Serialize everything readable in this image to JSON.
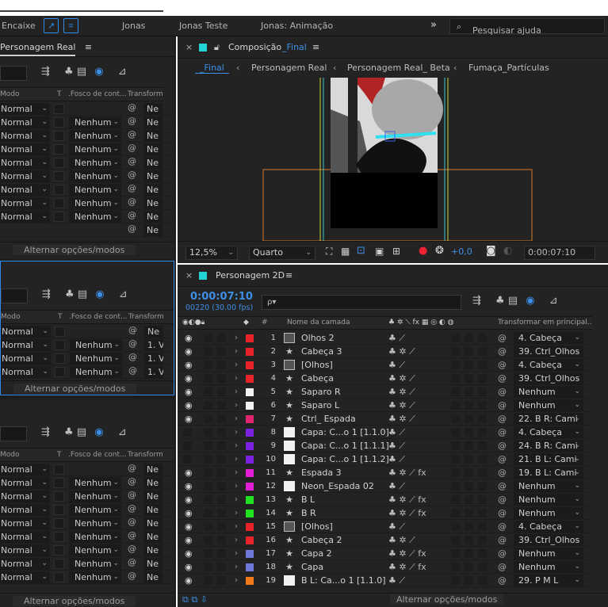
{
  "workspace": {
    "encaixe_label": "Encaixe",
    "tabs": [
      "Jonas",
      "Jonas Teste",
      "Jonas: Animação"
    ],
    "overflow": "»",
    "help_placeholder": "Pesquisar ajuda"
  },
  "project_panels": [
    {
      "title": "Personagem Real",
      "menu": "≡",
      "columns": {
        "modo": "Modo",
        "t": "T",
        "fosco": ".Fosco de cont...",
        "transform": "Transform"
      },
      "rows": [
        {
          "mode": "Normal",
          "fosco": "",
          "trf": "Ne"
        },
        {
          "mode": "Normal",
          "fosco": "Nenhum",
          "trf": "Ne"
        },
        {
          "mode": "Normal",
          "fosco": "Nenhum",
          "trf": "Ne"
        },
        {
          "mode": "Normal",
          "fosco": "Nenhum",
          "trf": "Ne"
        },
        {
          "mode": "Normal",
          "fosco": "Nenhum",
          "trf": "Ne"
        },
        {
          "mode": "Normal",
          "fosco": "Nenhum",
          "trf": "Ne"
        },
        {
          "mode": "Normal",
          "fosco": "Nenhum",
          "trf": "Ne"
        },
        {
          "mode": "Normal",
          "fosco": "Nenhum",
          "trf": "Ne"
        },
        {
          "mode": "Normal",
          "fosco": "Nenhum",
          "trf": "Ne"
        },
        {
          "mode": "",
          "fosco": "",
          "trf": "Ne"
        }
      ],
      "toggle": "Alternar opções/modos"
    },
    {
      "title": "",
      "columns": {
        "modo": "Modo",
        "t": "T",
        "fosco": ".Fosco de cont...",
        "transform": "Transform"
      },
      "rows": [
        {
          "mode": "Normal",
          "fosco": "",
          "trf": "Ne"
        },
        {
          "mode": "Normal",
          "fosco": "Nenhum",
          "trf": "1. V"
        },
        {
          "mode": "Normal",
          "fosco": "Nenhum",
          "trf": "1. V"
        },
        {
          "mode": "Normal",
          "fosco": "Nenhum",
          "trf": "1. V"
        }
      ],
      "toggle": "Alternar opções/modos"
    },
    {
      "title": "",
      "columns": {
        "modo": "Modo",
        "t": "T",
        "fosco": ".Fosco de cont...",
        "transform": "Transform"
      },
      "rows": [
        {
          "mode": "Normal",
          "fosco": "",
          "trf": "Ne"
        },
        {
          "mode": "Normal",
          "fosco": "Nenhum",
          "trf": "Ne"
        },
        {
          "mode": "Normal",
          "fosco": "Nenhum",
          "trf": "Ne"
        },
        {
          "mode": "Normal",
          "fosco": "Nenhum",
          "trf": "Ne"
        },
        {
          "mode": "Normal",
          "fosco": "Nenhum",
          "trf": "Ne"
        },
        {
          "mode": "Normal",
          "fosco": "Nenhum",
          "trf": "Ne"
        },
        {
          "mode": "Normal",
          "fosco": "Nenhum",
          "trf": "Ne"
        },
        {
          "mode": "Normal",
          "fosco": "Nenhum",
          "trf": "Ne"
        },
        {
          "mode": "Normal",
          "fosco": "Nenhum",
          "trf": "Ne"
        }
      ],
      "toggle": "Alternar opções/modos"
    }
  ],
  "composition": {
    "close": "×",
    "title": "Composição",
    "name": "_Final",
    "menu": "≡",
    "breadcrumbs": [
      "_Final",
      "Personagem Real",
      "Personagem Real_ Beta",
      "Fumaça_Partículas"
    ],
    "zoom": "12,5%",
    "resolution": "Quarto",
    "exposure": "+0,0",
    "current_time": "0:00:07:10"
  },
  "timeline": {
    "close": "×",
    "title": "Personagem 2D",
    "menu": "≡",
    "timecode": "0:00:07:10",
    "frames": "00220 (30.00 fps)",
    "search_placeholder": "ρ▾",
    "columns": {
      "num": "#",
      "name": "Nome da camada",
      "parent": "Transformar em principal..."
    },
    "layers": [
      {
        "num": "1",
        "name": "Olhos 2",
        "label": "#e8232a",
        "type": "comp",
        "eye": true,
        "shy": false,
        "fx": false,
        "parent": "4. Cabeça"
      },
      {
        "num": "2",
        "name": "Cabeça 3",
        "label": "#e8232a",
        "type": "star",
        "eye": true,
        "shy": true,
        "fx": false,
        "parent": "39. Ctrl_Olhos"
      },
      {
        "num": "3",
        "name": "[Olhos]",
        "label": "#e8232a",
        "type": "comp",
        "eye": true,
        "shy": false,
        "fx": false,
        "parent": "4. Cabeça"
      },
      {
        "num": "4",
        "name": "Cabeça",
        "label": "#e8232a",
        "type": "star",
        "eye": true,
        "shy": true,
        "fx": false,
        "parent": "39. Ctrl_Olhos"
      },
      {
        "num": "5",
        "name": "Saparo R",
        "label": "#f2f2f2",
        "type": "star",
        "eye": true,
        "shy": true,
        "fx": false,
        "parent": "Nenhum"
      },
      {
        "num": "6",
        "name": "Saparo L",
        "label": "#f2f2f2",
        "type": "star",
        "eye": true,
        "shy": true,
        "fx": false,
        "parent": "Nenhum"
      },
      {
        "num": "7",
        "name": "Ctrl_ Espada",
        "label": "#e0246f",
        "type": "star",
        "eye": true,
        "shy": true,
        "fx": false,
        "parent": "22. B R: Cami"
      },
      {
        "num": "8",
        "name": "Capa: C...o 1 [1.1.0]",
        "label": "#7a22e0",
        "type": "solid",
        "eye": false,
        "shy": false,
        "fx": false,
        "parent": "4. Cabeça"
      },
      {
        "num": "9",
        "name": "Capa: C...o 1 [1.1.1]",
        "label": "#7a22e0",
        "type": "solid",
        "eye": false,
        "shy": false,
        "fx": false,
        "parent": "24. B R: Cami"
      },
      {
        "num": "10",
        "name": "Capa: C...o 1 [1.1.2]",
        "label": "#7a22e0",
        "type": "solid",
        "eye": false,
        "shy": false,
        "fx": false,
        "parent": "21. B L: Cami"
      },
      {
        "num": "11",
        "name": "Espada 3",
        "label": "#e21fd6",
        "type": "star",
        "eye": true,
        "shy": true,
        "fx": true,
        "parent": "19. B L: Cami"
      },
      {
        "num": "12",
        "name": "Neon_Espada 02",
        "label": "#e21fd6",
        "type": "solid",
        "eye": true,
        "shy": false,
        "fx": false,
        "parent": "Nenhum"
      },
      {
        "num": "13",
        "name": "B L",
        "label": "#22e022",
        "type": "star",
        "eye": true,
        "shy": true,
        "fx": true,
        "parent": "Nenhum"
      },
      {
        "num": "14",
        "name": "B R",
        "label": "#22e022",
        "type": "star",
        "eye": true,
        "shy": true,
        "fx": true,
        "parent": "Nenhum"
      },
      {
        "num": "15",
        "name": "[Olhos]",
        "label": "#e8232a",
        "type": "comp",
        "eye": true,
        "shy": false,
        "fx": false,
        "parent": "4. Cabeça"
      },
      {
        "num": "16",
        "name": "Cabeça 2",
        "label": "#e8232a",
        "type": "star",
        "eye": true,
        "shy": true,
        "fx": false,
        "parent": "39. Ctrl_Olhos"
      },
      {
        "num": "17",
        "name": "Capa 2",
        "label": "#6f78d8",
        "type": "star",
        "eye": true,
        "shy": true,
        "fx": true,
        "parent": "Nenhum"
      },
      {
        "num": "18",
        "name": "Capa",
        "label": "#6f78d8",
        "type": "star",
        "eye": true,
        "shy": true,
        "fx": true,
        "parent": "Nenhum"
      },
      {
        "num": "19",
        "name": "B L: Ca...o 1 [1.1.0]",
        "label": "#f07a18",
        "type": "solid",
        "eye": true,
        "shy": false,
        "fx": false,
        "parent": "29. P M L"
      }
    ],
    "toggle": "Alternar opções/modos"
  },
  "colors": {
    "accent": "#2d8ceb",
    "timecode": "#3d8fe6",
    "comp_swatch": "#23d4d4"
  }
}
